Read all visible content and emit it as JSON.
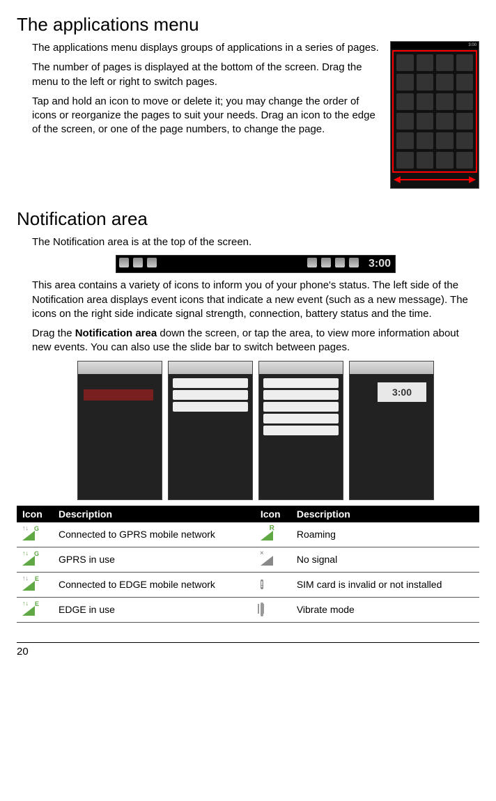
{
  "page_number": "20",
  "section1": {
    "title": "The applications menu",
    "p1": "The applications menu displays groups of applications in a series of pages.",
    "p2": "The number of pages is displayed at the bottom of the screen. Drag the menu to the left or right to switch pages.",
    "p3": "Tap and hold an icon to move or delete it; you may change the order of icons or reorganize the pages to suit your needs. Drag an icon to the edge of the screen, or one of the page numbers, to change the page."
  },
  "section2": {
    "title": "Notification area",
    "p1": "The Notification area is at the top of the screen.",
    "p2": "This area contains a variety of icons to inform you of your phone's status. The left side of the Notification area displays event icons that indicate a new event (such as a new message). The icons on the right side indicate signal strength, connection, battery status and the time.",
    "p3_a": "Drag the ",
    "p3_bold": "Notification area",
    "p3_b": " down the screen, or tap the area, to view more information about new events. You can also use the slide bar to switch between pages."
  },
  "notif_bar": {
    "time": "3:00"
  },
  "shot_clock": "3:00",
  "table": {
    "headers": {
      "icon": "Icon",
      "desc": "Description"
    },
    "rows": [
      {
        "l_desc": "Connected to GPRS mobile network",
        "r_desc": "Roaming"
      },
      {
        "l_desc": "GPRS in use",
        "r_desc": "No signal"
      },
      {
        "l_desc": "Connected to EDGE mobile network",
        "r_desc": "SIM card is invalid or not installed"
      },
      {
        "l_desc": "EDGE in use",
        "r_desc": "Vibrate mode"
      }
    ]
  }
}
